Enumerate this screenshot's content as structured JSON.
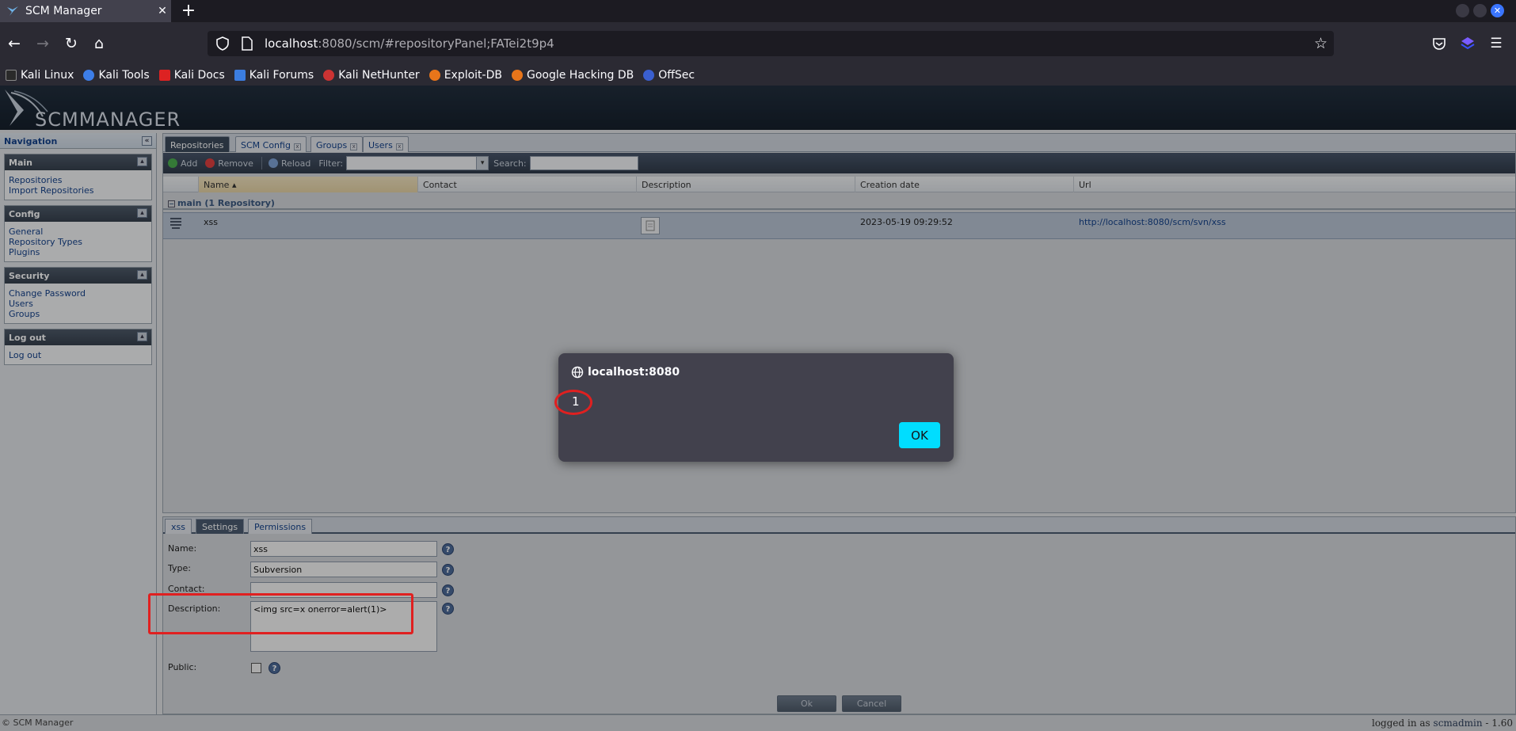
{
  "browser": {
    "tab_title": "SCM Manager",
    "url_host": "localhost",
    "url_rest": ":8080/scm/#repositoryPanel;FATei2t9p4",
    "bookmarks": [
      "Kali Linux",
      "Kali Tools",
      "Kali Docs",
      "Kali Forums",
      "Kali NetHunter",
      "Exploit-DB",
      "Google Hacking DB",
      "OffSec"
    ]
  },
  "app": {
    "logo_text": "SCMMANAGER",
    "nav": {
      "title": "Navigation",
      "sections": [
        {
          "title": "Main",
          "links": [
            "Repositories",
            "Import Repositories"
          ]
        },
        {
          "title": "Config",
          "links": [
            "General",
            "Repository Types",
            "Plugins"
          ]
        },
        {
          "title": "Security",
          "links": [
            "Change Password",
            "Users",
            "Groups"
          ]
        },
        {
          "title": "Log out",
          "links": [
            "Log out"
          ]
        }
      ]
    },
    "tabs": [
      "Repositories",
      "SCM Config",
      "Groups",
      "Users"
    ],
    "toolbar": {
      "add": "Add",
      "remove": "Remove",
      "reload": "Reload",
      "filter": "Filter:",
      "search": "Search:"
    },
    "grid": {
      "columns": [
        "Name",
        "Contact",
        "Description",
        "Creation date",
        "Url"
      ],
      "group": "main (1 Repository)",
      "row": {
        "name": "xss",
        "created": "2023-05-19 09:29:52",
        "url": "http://localhost:8080/scm/svn/xss"
      }
    },
    "detail": {
      "tabs": [
        "xss",
        "Settings",
        "Permissions"
      ],
      "labels": {
        "name": "Name:",
        "type": "Type:",
        "contact": "Contact:",
        "description": "Description:",
        "public": "Public:"
      },
      "values": {
        "name": "xss",
        "type": "Subversion",
        "contact": "",
        "description": "<img src=x onerror=alert(1)>"
      },
      "ok": "Ok",
      "cancel": "Cancel"
    },
    "status": {
      "left": "© SCM Manager",
      "logged_prefix": "logged in as",
      "user": "scmadmin",
      "version_suffix": "- 1.60"
    }
  },
  "dialog": {
    "origin": "localhost:8080",
    "message": "1",
    "ok": "OK"
  },
  "colors": {
    "accent_button": "#00ddff",
    "annotation_red": "#e02020"
  }
}
